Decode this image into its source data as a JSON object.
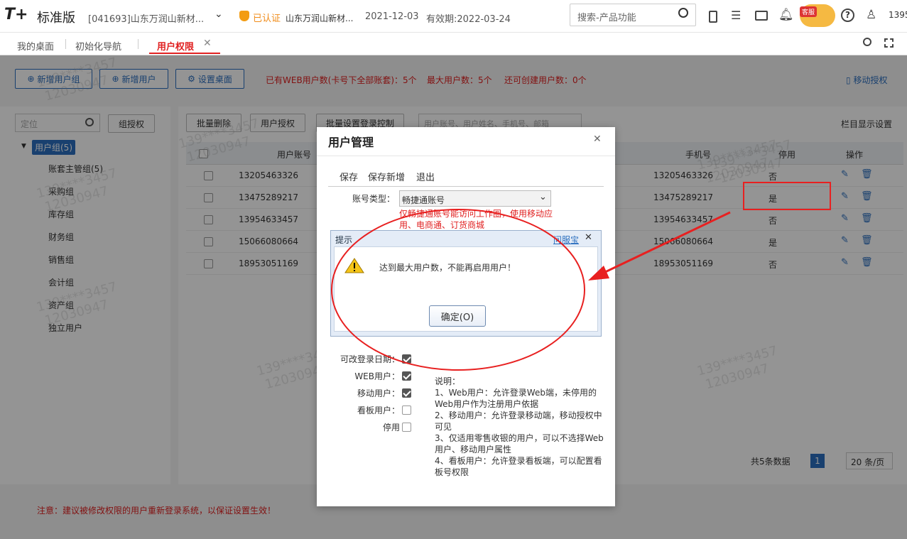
{
  "header": {
    "logo": "T+",
    "edition": "标准版",
    "company": "[041693]山东万润山新材...",
    "verified": "已认证",
    "company2": "山东万润山新材...",
    "date": "2021-12-03",
    "expiry": "有效期:2022-03-24",
    "search_placeholder": "搜索-产品功能",
    "service_badge": "客服",
    "user": "1395"
  },
  "tabs": [
    {
      "label": "我的桌面"
    },
    {
      "label": "初始化导航"
    },
    {
      "label": "用户权限"
    }
  ],
  "toolbar": {
    "add_group": "新增用户组",
    "add_user": "新增用户",
    "set_desktop": "设置桌面",
    "info1": "已有WEB用户数(卡号下全部账套)：5个",
    "info2": "最大用户数：5个",
    "info3": "还可创建用户数：0个",
    "mobile_auth": "移动授权"
  },
  "left": {
    "locate_placeholder": "定位",
    "group_auth": "组授权",
    "root": "用户组(5)",
    "groups": [
      "账套主管组(5)",
      "采购组",
      "库存组",
      "财务组",
      "销售组",
      "会计组",
      "资产组",
      "独立用户"
    ]
  },
  "grid": {
    "batch_delete": "批量删除",
    "user_auth": "用户授权",
    "batch_login": "批量设置登录控制",
    "search_placeholder": "用户账号、用户姓名、手机号、邮箱",
    "column_settings": "栏目显示设置",
    "headers": {
      "account": "用户账号",
      "phone": "手机号",
      "disabled": "停用",
      "ops": "操作"
    },
    "rows": [
      {
        "account": "13205463326",
        "phone": "13205463326",
        "disabled": "否"
      },
      {
        "account": "13475289217",
        "phone": "13475289217",
        "disabled": "是"
      },
      {
        "account": "13954633457",
        "phone": "13954633457",
        "disabled": "否"
      },
      {
        "account": "15066080664",
        "phone": "15066080664",
        "disabled": "是"
      },
      {
        "account": "18953051169",
        "phone": "18953051169",
        "disabled": "否"
      }
    ],
    "total": "共5条数据",
    "page": "1",
    "page_size": "20 条/页"
  },
  "notice": "注意：建议被修改权限的用户重新登录系统，以保证设置生效！",
  "watermark": {
    "a": "139****3457",
    "b": "12030947"
  },
  "dialog": {
    "title": "用户管理",
    "actions": [
      "保存",
      "保存新增",
      "退出"
    ],
    "account_type_label": "账号类型：",
    "account_type_value": "畅捷通账号",
    "hint": "仅畅捷通账号能访问工作圈，使用移动应用、电商通、订货商城",
    "options": [
      {
        "label": "可改登录日期：",
        "checked": true
      },
      {
        "label": "WEB用户：",
        "checked": true
      },
      {
        "label": "移动用户：",
        "checked": true
      },
      {
        "label": "看板用户：",
        "checked": false
      },
      {
        "label": "停用",
        "checked": false
      }
    ],
    "notes": [
      "说明：",
      "1、Web用户：允许登录Web端，未停用的Web用户作为注册用户依据",
      "2、移动用户：允许登录移动端，移动授权中可见",
      "3、仅适用零售收银的用户，可以不选择Web用户、移动用户属性",
      "4、看板用户：允许登录看板端，可以配置看板号权限"
    ]
  },
  "alert": {
    "title": "提示",
    "helper": "问服宝",
    "message": "达到最大用户数，不能再启用用户！",
    "ok": "确定(O)"
  },
  "colors": {
    "accent": "#2c6fbf",
    "annotation": "#e82020"
  }
}
